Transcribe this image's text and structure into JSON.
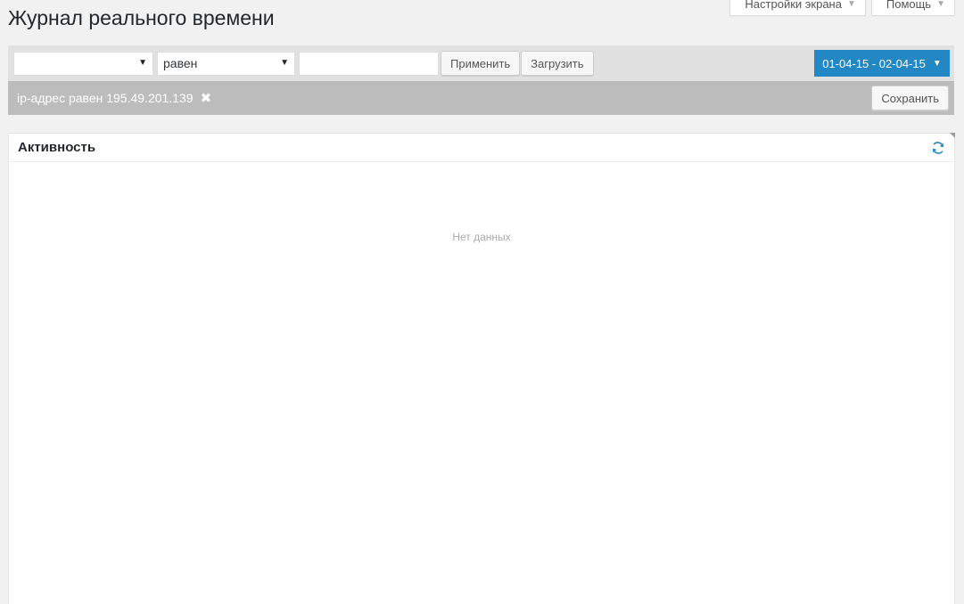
{
  "meta_tabs": {
    "screen_options": "Настройки экрана",
    "help": "Помощь"
  },
  "page_title": "Журнал реального времени",
  "filter_bar": {
    "field_select_value": "",
    "operator_select_value": "равен",
    "value_input": "",
    "apply_label": "Применить",
    "load_label": "Загрузить",
    "date_range": "01-04-15 - 02-04-15"
  },
  "active_filters": {
    "items": [
      {
        "label": "ip-адрес равен 195.49.201.139"
      }
    ],
    "save_label": "Сохранить"
  },
  "panel": {
    "title": "Активность",
    "empty_message": "Нет данных"
  },
  "colors": {
    "accent": "#2187c5",
    "filter_bar_bg": "#e1e1e1",
    "active_filter_bg": "#bcbcbc"
  }
}
